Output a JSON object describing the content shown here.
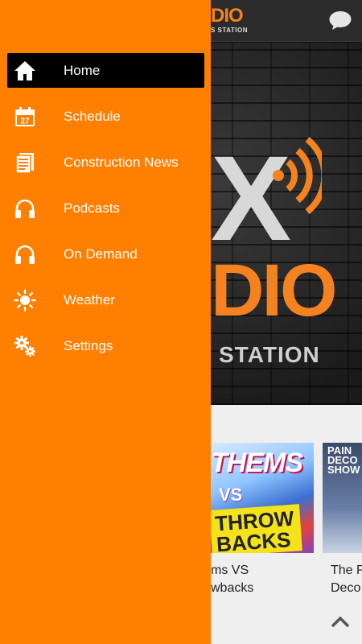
{
  "drawer": {
    "items": [
      {
        "label": "Home",
        "icon": "home-icon",
        "active": true
      },
      {
        "label": "Schedule",
        "icon": "calendar-icon",
        "calendar_day": "27"
      },
      {
        "label": "Construction News",
        "icon": "document-icon"
      },
      {
        "label": "Podcasts",
        "icon": "headphones-icon"
      },
      {
        "label": "On Demand",
        "icon": "headphones-icon"
      },
      {
        "label": "Weather",
        "icon": "sun-icon"
      },
      {
        "label": "Settings",
        "icon": "gears-icon"
      }
    ]
  },
  "header": {
    "logo_text": "DIO",
    "logo_tagline": "S STATION"
  },
  "hero": {
    "logo_x": "X",
    "logo_dio": "DIO",
    "logo_station": "STATION"
  },
  "cards": [
    {
      "art_top": "THEMS",
      "art_mid": "VS",
      "art_bottom": "THROW BACKS",
      "caption_line1": "ms VS",
      "caption_line2": "wbacks"
    },
    {
      "art_text": "PAIN DECO SHOW",
      "caption_line1": "The P",
      "caption_line2": "Deco"
    }
  ],
  "colors": {
    "accent": "#ff7f00",
    "logo_orange": "#f58220",
    "active_item_bg": "#000000",
    "topbar": "#2b2b2b"
  }
}
